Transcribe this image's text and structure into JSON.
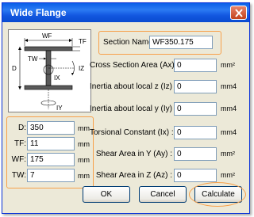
{
  "window": {
    "title": "Wide Flange"
  },
  "diagram": {
    "labels": {
      "wf": "WF",
      "tf": "TF",
      "tw": "TW",
      "d": "D",
      "iz": "IZ",
      "ix": "IX",
      "iy": "IY"
    }
  },
  "section": {
    "label": "Section Name :",
    "value": "WF350.175"
  },
  "dims": [
    {
      "label": "D:",
      "value": "350",
      "unit": "mm"
    },
    {
      "label": "TF:",
      "value": "11",
      "unit": "mm"
    },
    {
      "label": "WF:",
      "value": "175",
      "unit": "mm"
    },
    {
      "label": "TW:",
      "value": "7",
      "unit": "mm"
    }
  ],
  "props": [
    {
      "label": "Cross Section Area (Ax) :",
      "value": "0",
      "unit": "mm²"
    },
    {
      "label": "Inertia about local z (Iz) :",
      "value": "0",
      "unit": "mm4"
    },
    {
      "label": "Inertia about local y (Iy) :",
      "value": "0",
      "unit": "mm4"
    },
    {
      "label": "Torsional Constant (Ix) :",
      "value": "0",
      "unit": "mm4"
    },
    {
      "label": "Shear Area in Y (Ay) :",
      "value": "0",
      "unit": "mm²"
    },
    {
      "label": "Shear Area in Z (Az) :",
      "value": "0",
      "unit": "mm²"
    }
  ],
  "buttons": {
    "ok": "OK",
    "cancel": "Cancel",
    "calculate": "Calculate"
  },
  "colors": {
    "highlight": "#f7a04a",
    "titlebar": "#0a5fe8",
    "face": "#ece9d8"
  }
}
